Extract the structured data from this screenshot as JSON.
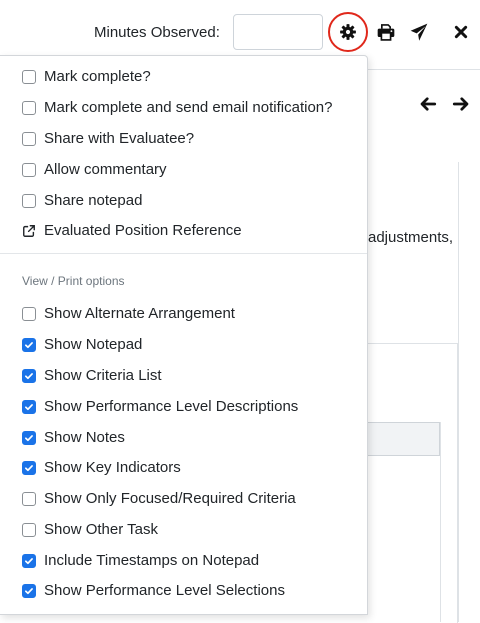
{
  "toolbar": {
    "minutes_label": "Minutes Observed:",
    "minutes_value": "",
    "icons": [
      "gear-icon",
      "print-icon",
      "paper-plane-icon",
      "close-icon"
    ],
    "highlight_color": "#e0281b"
  },
  "navigation": {
    "icons": [
      "arrow-left-icon",
      "arrow-right-icon"
    ]
  },
  "background": {
    "visible_text": "adjustments,"
  },
  "menu": {
    "items": [
      {
        "label": "Mark complete?",
        "checked": false
      },
      {
        "label": "Mark complete and send email notification?",
        "checked": false
      },
      {
        "label": "Share with Evaluatee?",
        "checked": false
      },
      {
        "label": "Allow commentary",
        "checked": false
      },
      {
        "label": "Share notepad",
        "checked": false
      }
    ],
    "link": {
      "label": "Evaluated Position Reference",
      "icon": "external-link-icon"
    },
    "view_print_header": "View / Print options",
    "view_print_items": [
      {
        "label": "Show Alternate Arrangement",
        "checked": false
      },
      {
        "label": "Show Notepad",
        "checked": true
      },
      {
        "label": "Show Criteria List",
        "checked": true
      },
      {
        "label": "Show Performance Level Descriptions",
        "checked": true
      },
      {
        "label": "Show Notes",
        "checked": true
      },
      {
        "label": "Show Key Indicators",
        "checked": true
      },
      {
        "label": "Show Only Focused/Required Criteria",
        "checked": false
      },
      {
        "label": "Show Other Task",
        "checked": false
      },
      {
        "label": "Include Timestamps on Notepad",
        "checked": true
      },
      {
        "label": "Show Performance Level Selections",
        "checked": true
      }
    ],
    "checkbox_checked_color": "#1a73e8"
  }
}
